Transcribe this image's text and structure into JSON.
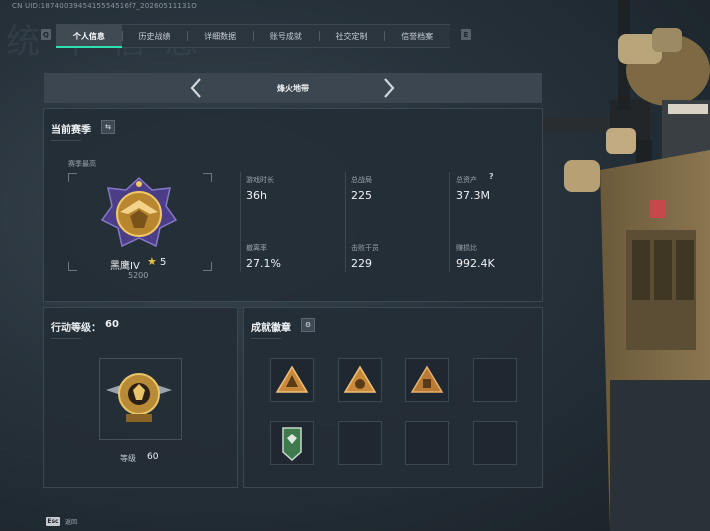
{
  "header": {
    "uid": "CN UID:1874003945415554516f7_20260511131O",
    "bg_title": "统 个 信 息"
  },
  "tabs": [
    {
      "label": "个人信息",
      "active": true
    },
    {
      "label": "历史战绩",
      "active": false
    },
    {
      "label": "详细数据",
      "active": false
    },
    {
      "label": "账号成就",
      "active": false
    },
    {
      "label": "社交定制",
      "active": false
    },
    {
      "label": "信誉档案",
      "active": false
    }
  ],
  "tab_nav": {
    "left_key": "Q",
    "right_key": "E"
  },
  "mode_selector": {
    "label": "烽火地带",
    "prev_icon": "chevron-left-icon",
    "next_icon": "chevron-right-icon"
  },
  "season": {
    "title": "当前赛季",
    "switch_icon": "swap-icon",
    "highest_label": "赛季最高",
    "rank_name": "黑鹰IV",
    "rank_stars": "5",
    "rank_points": "5200",
    "stats": [
      {
        "label": "游戏时长",
        "value": "36h"
      },
      {
        "label": "总战局",
        "value": "225"
      },
      {
        "label": "总资产",
        "value": "37.3M",
        "help": "?"
      },
      {
        "label": "撤离率",
        "value": "27.1%"
      },
      {
        "label": "击败干员",
        "value": "229"
      },
      {
        "label": "赚损比",
        "value": "992.4K"
      }
    ]
  },
  "action_level": {
    "title": "行动等级：",
    "value": "60",
    "level_label": "等级",
    "level_value": "60"
  },
  "badges": {
    "title": "成就徽章",
    "settings_icon": "gear-icon",
    "slots": [
      {
        "icon": "badge-triangle-icon",
        "color": "#c88a3a"
      },
      {
        "icon": "badge-triangle-icon",
        "color": "#c88a3a"
      },
      {
        "icon": "badge-triangle-icon",
        "color": "#b87a34"
      },
      {
        "icon": "",
        "color": ""
      },
      {
        "icon": "badge-shield-icon",
        "color": "#3f7a4e"
      },
      {
        "icon": "",
        "color": ""
      },
      {
        "icon": "",
        "color": ""
      },
      {
        "icon": "",
        "color": ""
      }
    ]
  },
  "footer": {
    "key": "Esc",
    "label": "返回"
  },
  "colors": {
    "accent": "#2fe0b0",
    "panel": "#242e36",
    "gold": "#d4a54a"
  }
}
